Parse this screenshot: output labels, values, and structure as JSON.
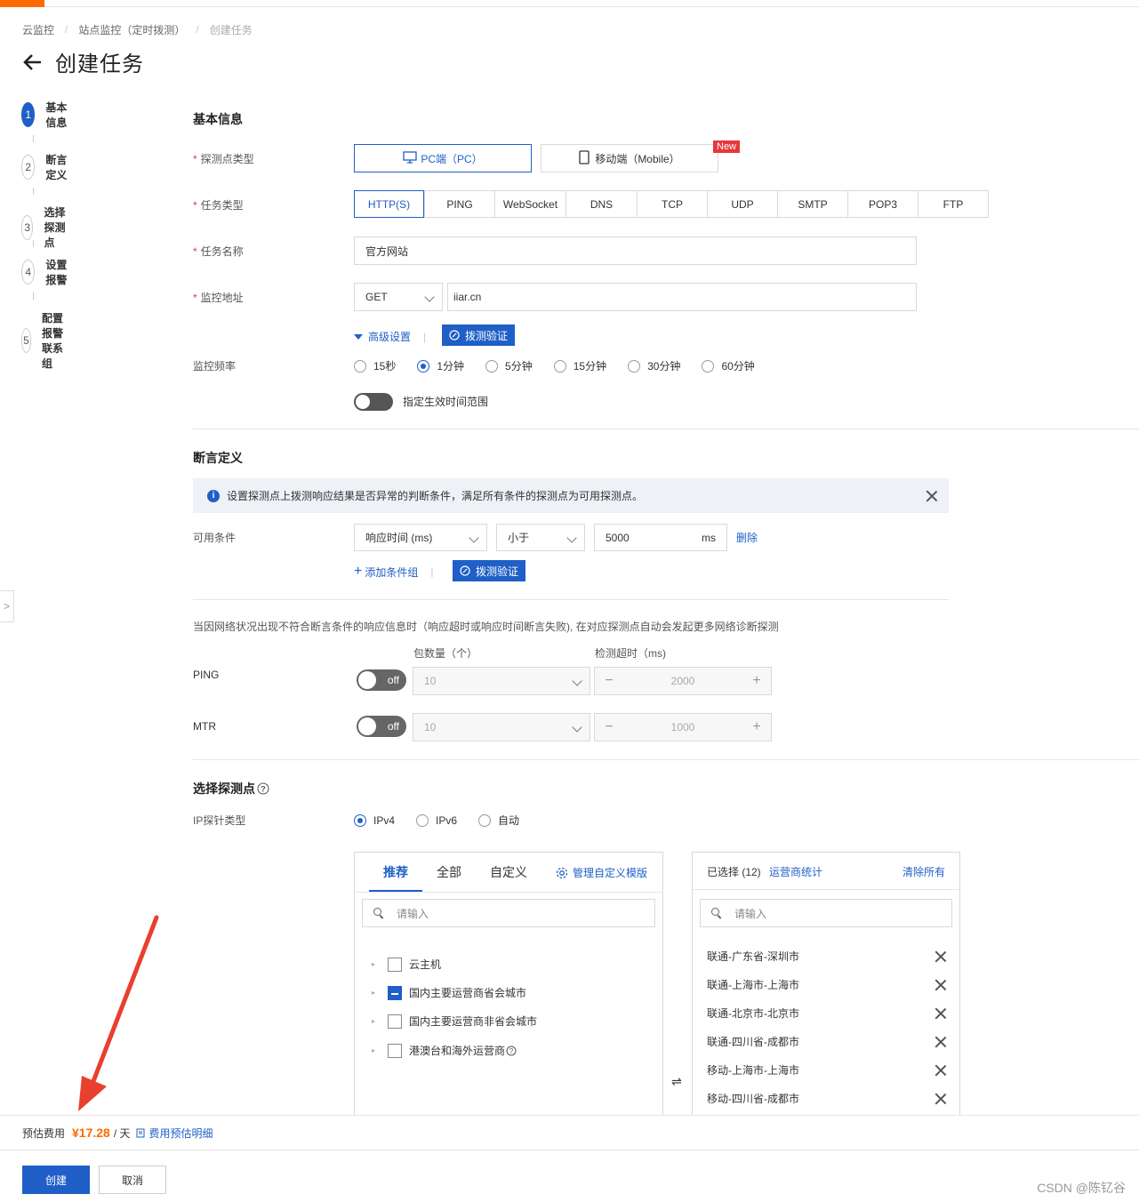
{
  "breadcrumb": [
    "云监控",
    "站点监控（定时拨测）",
    "创建任务"
  ],
  "page": {
    "title": "创建任务"
  },
  "steps": [
    {
      "num": "1",
      "label": "基本信息"
    },
    {
      "num": "2",
      "label": "断言定义"
    },
    {
      "num": "3",
      "label": "选择探测点"
    },
    {
      "num": "4",
      "label": "设置报警"
    },
    {
      "num": "5",
      "label": "配置报警联系组"
    }
  ],
  "basic": {
    "title": "基本信息",
    "probe_type_label": "探测点类型",
    "probe_pc": "PC端（PC）",
    "probe_mobile": "移动端（Mobile）",
    "new_badge": "New",
    "task_type_label": "任务类型",
    "task_types": [
      "HTTP(S)",
      "PING",
      "WebSocket",
      "DNS",
      "TCP",
      "UDP",
      "SMTP",
      "POP3",
      "FTP"
    ],
    "task_name_label": "任务名称",
    "task_name_value": "官方网站",
    "address_label": "监控地址",
    "method": "GET",
    "address_value": "iiar.cn",
    "advanced": "高级设置",
    "verify": "拨测验证",
    "freq_label": "监控频率",
    "freqs": [
      "15秒",
      "1分钟",
      "5分钟",
      "15分钟",
      "30分钟",
      "60分钟"
    ],
    "freq_selected": "1分钟",
    "time_range": "指定生效时间范围"
  },
  "assert": {
    "title": "断言定义",
    "info": "设置探测点上拨测响应结果是否异常的判断条件，满足所有条件的探测点为可用探测点。",
    "cond_label": "可用条件",
    "metric": "响应时间 (ms)",
    "op": "小于",
    "value": "5000",
    "unit": "ms",
    "delete": "删除",
    "add_group": "添加条件组",
    "verify": "拨测验证",
    "diag_desc": "当因网络状况出现不符合断言条件的响应信息时（响应超时或响应时间断言失败), 在对应探测点自动会发起更多网络诊断探测",
    "packet_label": "包数量（个）",
    "timeout_label": "检测超时（ms)",
    "ping_label": "PING",
    "mtr_label": "MTR",
    "off": "off",
    "ping_count": "10",
    "ping_timeout": "2000",
    "mtr_count": "10",
    "mtr_timeout": "1000"
  },
  "probes": {
    "title": "选择探测点",
    "ip_label": "IP探针类型",
    "ip_types": [
      "IPv4",
      "IPv6",
      "自动"
    ],
    "ip_selected": "IPv4",
    "tabs": [
      "推荐",
      "全部",
      "自定义"
    ],
    "manage": "管理自定义模版",
    "search_placeholder": "请输入",
    "tree": [
      "云主机",
      "国内主要运营商省会城市",
      "国内主要运营商非省会城市",
      "港澳台和海外运营商"
    ],
    "selected_header": "已选择 (12)",
    "operator_stats": "运营商统计",
    "clear_all": "清除所有",
    "selected": [
      "联通-广东省-深圳市",
      "联通-上海市-上海市",
      "联通-北京市-北京市",
      "联通-四川省-成都市",
      "移动-上海市-上海市",
      "移动-四川省-成都市"
    ]
  },
  "footer": {
    "cost_label": "预估费用",
    "price": "¥17.28",
    "per_day": "/ 天",
    "detail": "费用预估明细",
    "create": "创建",
    "cancel": "取消"
  },
  "watermark": "CSDN @陈钇谷",
  "colors": {
    "accent": "#1f5fc7",
    "orange": "#ff6a00",
    "annotation_arrow": "#e8402e"
  }
}
